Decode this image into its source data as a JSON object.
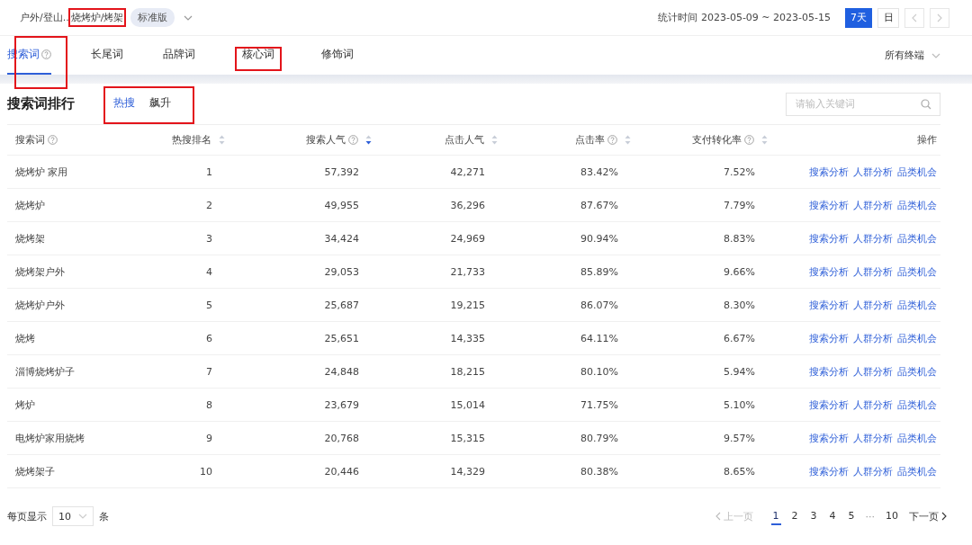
{
  "header": {
    "breadcrumb": [
      {
        "text": "户外/登山..",
        "highlighted": false
      },
      {
        "text": "烧烤炉/烤架",
        "highlighted": true
      }
    ],
    "edition_badge": "标准版",
    "stat_label": "统计时间 2023-05-09 ~ 2023-05-15",
    "periods": [
      {
        "label": "7天",
        "selected": true
      },
      {
        "label": "日",
        "selected": false
      }
    ]
  },
  "tabs": [
    {
      "label": "搜索词",
      "help": true,
      "selected": true,
      "highlighted": true
    },
    {
      "label": "长尾词",
      "help": false,
      "selected": false,
      "highlighted": false
    },
    {
      "label": "品牌词",
      "help": false,
      "selected": false,
      "highlighted": false
    },
    {
      "label": "核心词",
      "help": false,
      "selected": false,
      "highlighted": true
    },
    {
      "label": "修饰词",
      "help": false,
      "selected": false,
      "highlighted": false
    }
  ],
  "terminal_select": "所有终端",
  "ranking": {
    "title": "搜索词排行",
    "subtabs_highlighted": true,
    "subtabs": [
      {
        "label": "热搜",
        "selected": true
      },
      {
        "label": "飙升",
        "selected": false
      }
    ],
    "search": {
      "placeholder": "请输入关键词"
    }
  },
  "table": {
    "columns": [
      {
        "label": "搜索词",
        "help": true
      },
      {
        "label": "热搜排名",
        "help": false,
        "sorted": false
      },
      {
        "label": "搜索人气",
        "help": true,
        "sorted": true
      },
      {
        "label": "点击人气",
        "help": false,
        "sorted": false
      },
      {
        "label": "点击率",
        "help": true,
        "sorted": false
      },
      {
        "label": "支付转化率",
        "help": true,
        "sorted": false
      },
      {
        "label": "操作",
        "help": false
      }
    ],
    "rows": [
      {
        "cells": [
          "烧烤炉 家用",
          "1",
          "57,392",
          "42,271",
          "83.42%",
          "7.52%"
        ],
        "actions": [
          "搜索分析",
          "人群分析",
          "品类机会"
        ]
      },
      {
        "cells": [
          "烧烤炉",
          "2",
          "49,955",
          "36,296",
          "87.67%",
          "7.79%"
        ],
        "actions": [
          "搜索分析",
          "人群分析",
          "品类机会"
        ]
      },
      {
        "cells": [
          "烧烤架",
          "3",
          "34,424",
          "24,969",
          "90.94%",
          "8.83%"
        ],
        "actions": [
          "搜索分析",
          "人群分析",
          "品类机会"
        ]
      },
      {
        "cells": [
          "烧烤架户外",
          "4",
          "29,053",
          "21,733",
          "85.89%",
          "9.66%"
        ],
        "actions": [
          "搜索分析",
          "人群分析",
          "品类机会"
        ]
      },
      {
        "cells": [
          "烧烤炉户外",
          "5",
          "25,687",
          "19,215",
          "86.07%",
          "8.30%"
        ],
        "actions": [
          "搜索分析",
          "人群分析",
          "品类机会"
        ]
      },
      {
        "cells": [
          "烧烤",
          "6",
          "25,651",
          "14,335",
          "64.11%",
          "6.67%"
        ],
        "actions": [
          "搜索分析",
          "人群分析",
          "品类机会"
        ]
      },
      {
        "cells": [
          "淄博烧烤炉子",
          "7",
          "24,848",
          "18,215",
          "80.10%",
          "5.94%"
        ],
        "actions": [
          "搜索分析",
          "人群分析",
          "品类机会"
        ]
      },
      {
        "cells": [
          "烤炉",
          "8",
          "23,679",
          "15,014",
          "71.75%",
          "5.10%"
        ],
        "actions": [
          "搜索分析",
          "人群分析",
          "品类机会"
        ]
      },
      {
        "cells": [
          "电烤炉家用烧烤",
          "9",
          "20,768",
          "15,315",
          "80.79%",
          "9.57%"
        ],
        "actions": [
          "搜索分析",
          "人群分析",
          "品类机会"
        ]
      },
      {
        "cells": [
          "烧烤架子",
          "10",
          "20,446",
          "14,329",
          "80.38%",
          "8.65%"
        ],
        "actions": [
          "搜索分析",
          "人群分析",
          "品类机会"
        ]
      }
    ]
  },
  "footer": {
    "page_size_label": "每页显示",
    "page_size": "10",
    "page_size_unit": "条",
    "pagination": [
      {
        "label": "上一页",
        "kind": "prev",
        "disabled": true
      },
      {
        "label": "1",
        "kind": "page",
        "selected": true
      },
      {
        "label": "2",
        "kind": "page",
        "selected": false
      },
      {
        "label": "3",
        "kind": "page",
        "selected": false
      },
      {
        "label": "4",
        "kind": "page",
        "selected": false
      },
      {
        "label": "5",
        "kind": "page",
        "selected": false
      },
      {
        "label": "···",
        "kind": "ellipsis"
      },
      {
        "label": "10",
        "kind": "page",
        "selected": false
      },
      {
        "label": "下一页",
        "kind": "next",
        "disabled": false
      }
    ]
  }
}
